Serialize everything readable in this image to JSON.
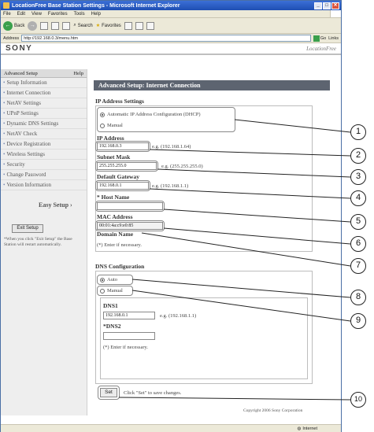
{
  "window": {
    "title": "LocationFree Base Station Settings - Microsoft Internet Explorer",
    "menu": [
      "File",
      "Edit",
      "View",
      "Favorites",
      "Tools",
      "Help"
    ],
    "toolbar": {
      "back": "Back",
      "search": "Search",
      "favorites": "Favorites"
    },
    "address_label": "Address",
    "address": "http://192.168.0.3/menu.htm",
    "go": "Go",
    "links": "Links",
    "status": "Internet"
  },
  "brand": {
    "logo": "SONY",
    "product": "LocationFree"
  },
  "sidebar": {
    "header": "Advanced Setup",
    "help": "Help",
    "items": [
      {
        "label": "Setup Information"
      },
      {
        "label": "Internet Connection"
      },
      {
        "label": "NetAV Settings"
      },
      {
        "label": "UPnP Settings"
      },
      {
        "label": "Dynamic DNS Settings"
      },
      {
        "label": "NetAV Check"
      },
      {
        "label": "Device Registration"
      },
      {
        "label": "Wireless Settings"
      },
      {
        "label": "Security"
      },
      {
        "label": "Change Password"
      },
      {
        "label": "Version Information"
      }
    ],
    "easy_setup": "Easy Setup",
    "exit_button": "Exit Setup",
    "exit_note": "*When you click \"Exit Setup\" the Base Station will restart automatically."
  },
  "main": {
    "title": "Advanced Setup: Internet Connection",
    "ip_section": "IP Address Settings",
    "radio_dhcp": "Automatic IP Address Configuration (DHCP)",
    "radio_manual": "Manual",
    "ip_label": "IP Address",
    "ip_value": "192.168.0.3",
    "ip_example": "e.g. (192.168.1.64)",
    "subnet_label": "Subnet Mask",
    "subnet_value": "255.255.255.0",
    "subnet_example": "e.g. (255.255.255.0)",
    "gateway_label": "Default Gateway",
    "gateway_value": "192.168.0.1",
    "gateway_example": "e.g. (192.168.1.1)",
    "host_label": "* Host Name",
    "host_value": "",
    "mac_label": "MAC Address",
    "mac_value": "00:01:4a:c9:e0:85",
    "domain_label": "Domain Name",
    "note1": "(*) Enter if necessary.",
    "dns_section": "DNS Configuration",
    "dns_auto": "Auto",
    "dns_manual": "Manual",
    "dns1_label": "DNS1",
    "dns1_value": "192.168.0.1",
    "dns1_example": "e.g. (192.168.1.1)",
    "dns2_label": "*DNS2",
    "dns2_value": "",
    "note2": "(*) Enter if necessary.",
    "set_button": "Set",
    "set_hint": "Click \"Set\" to save changes.",
    "copyright": "Copyright 2006 Sony Corporation"
  },
  "callouts": [
    "1",
    "2",
    "3",
    "4",
    "5",
    "6",
    "7",
    "8",
    "9",
    "10"
  ]
}
